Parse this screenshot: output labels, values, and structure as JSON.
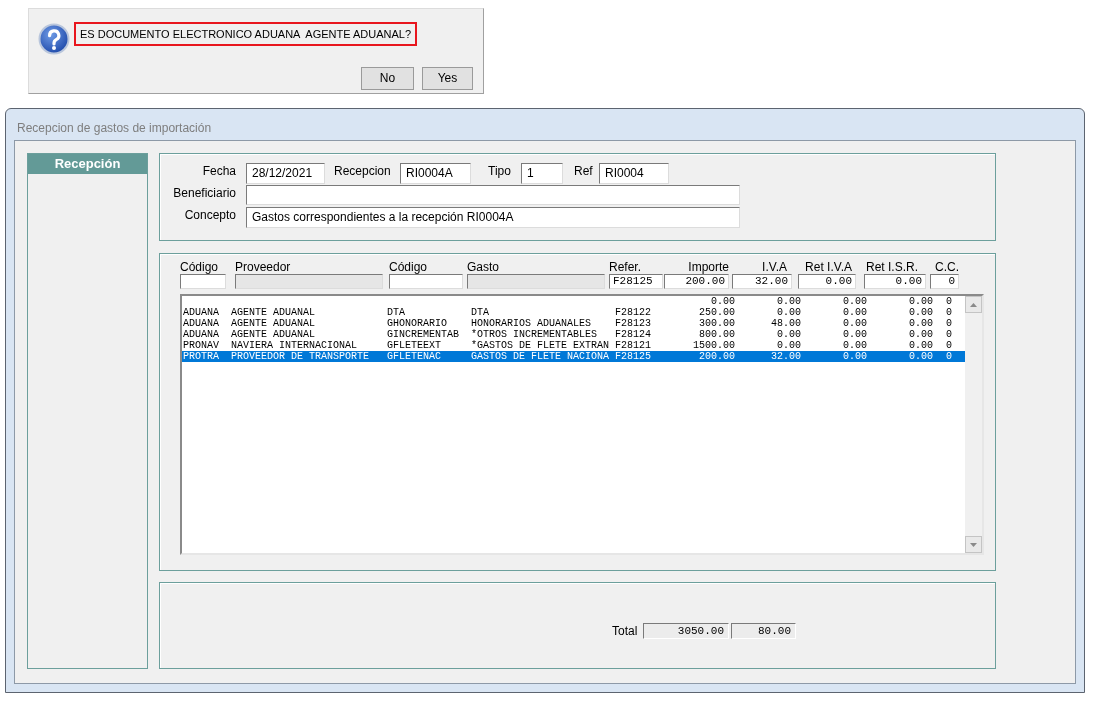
{
  "dialog": {
    "message": {
      "text": "ES DOCUMENTO ELECTRONICO ADUANA  AGENTE ADUANAL?",
      "highlighted": true
    },
    "buttons": [
      "No",
      "Yes"
    ]
  },
  "window": {
    "title": "Recepcion de gastos de importación"
  },
  "sidebar": {
    "title": "Recepción"
  },
  "header": {
    "fecha": {
      "label": "Fecha",
      "value": "28/12/2021"
    },
    "recepcion": {
      "label": "Recepcion",
      "value": "RI0004A"
    },
    "tipo": {
      "label": "Tipo",
      "value": "1"
    },
    "ref": {
      "label": "Ref",
      "value": "RI0004"
    },
    "beneficiario": {
      "label": "Beneficiario"
    },
    "concepto": {
      "label": "Concepto",
      "value": "Gastos correspondientes a la recepción RI0004A"
    }
  },
  "entry": {
    "columns": [
      {
        "label": "Código",
        "disabled": false
      },
      {
        "label": "Proveedor",
        "disabled": true
      },
      {
        "label": "Código",
        "disabled": false
      },
      {
        "label": "Gasto",
        "disabled": true
      },
      {
        "label": "Refer.",
        "value": "F28125",
        "disabled": false
      },
      {
        "label": "Importe",
        "value": "200.00",
        "disabled": false
      },
      {
        "label": "I.V.A",
        "value": "32.00",
        "disabled": false
      },
      {
        "label": "Ret I.V.A",
        "value": "0.00",
        "disabled": false
      },
      {
        "label": "Ret I.S.R.",
        "value": "0.00",
        "disabled": false
      },
      {
        "label": "C.C.",
        "value": "0",
        "disabled": false
      }
    ]
  },
  "list": {
    "rows": [
      {
        "importe": "0.00",
        "iva": "0.00",
        "ret_iva": "0.00",
        "ret_isr": "0.00",
        "cc": "0",
        "selected": false
      },
      {
        "codigo": "ADUANA",
        "proveedor": "AGENTE ADUANAL",
        "codigo_gasto": "DTA",
        "gasto": "DTA",
        "refer": "F28122",
        "importe": "250.00",
        "iva": "0.00",
        "ret_iva": "0.00",
        "ret_isr": "0.00",
        "cc": "0",
        "selected": false
      },
      {
        "codigo": "ADUANA",
        "proveedor": "AGENTE ADUANAL",
        "codigo_gasto": "GHONORARIO",
        "gasto": "HONORARIOS ADUANALES",
        "refer": "F28123",
        "importe": "300.00",
        "iva": "48.00",
        "ret_iva": "0.00",
        "ret_isr": "0.00",
        "cc": "0",
        "selected": false
      },
      {
        "codigo": "ADUANA",
        "proveedor": "AGENTE ADUANAL",
        "codigo_gasto": "GINCREMENTAB",
        "gasto": "*OTROS INCREMENTABLES",
        "refer": "F28124",
        "importe": "800.00",
        "iva": "0.00",
        "ret_iva": "0.00",
        "ret_isr": "0.00",
        "cc": "0",
        "selected": false
      },
      {
        "codigo": "PRONAV",
        "proveedor": "NAVIERA INTERNACIONAL",
        "codigo_gasto": "GFLETEEXT",
        "gasto": "*GASTOS DE FLETE EXTRAN",
        "refer": "F28121",
        "importe": "1500.00",
        "iva": "0.00",
        "ret_iva": "0.00",
        "ret_isr": "0.00",
        "cc": "0",
        "selected": false
      },
      {
        "codigo": "PROTRA",
        "proveedor": "PROVEEDOR DE TRANSPORTE",
        "codigo_gasto": "GFLETENAC",
        "gasto": "GASTOS DE FLETE NACIONA",
        "refer": "F28125",
        "importe": "200.00",
        "iva": "32.00",
        "ret_iva": "0.00",
        "ret_isr": "0.00",
        "cc": "0",
        "selected": true
      }
    ]
  },
  "totals": {
    "label": "Total",
    "values": [
      "3050.00",
      "80.00"
    ]
  }
}
